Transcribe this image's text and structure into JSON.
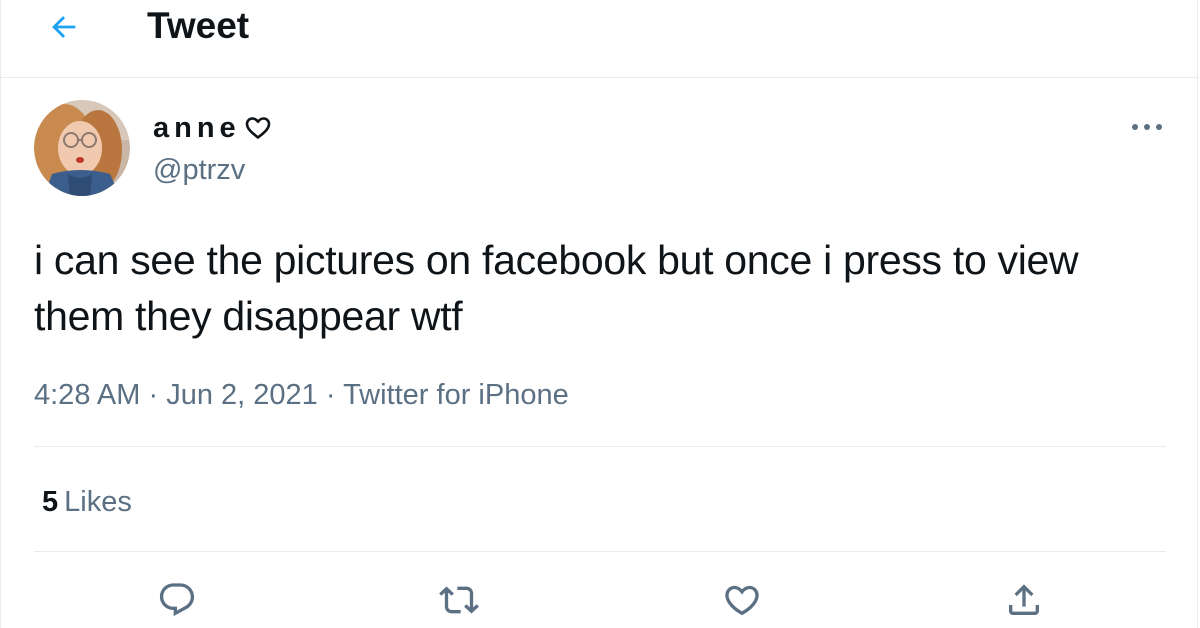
{
  "header": {
    "title": "Tweet",
    "back_icon": "arrow-left-icon",
    "accent_color": "#1da1f2"
  },
  "author": {
    "display_name": "anne",
    "name_emoji": "white-heart-icon",
    "handle": "@ptrzv",
    "avatar": "avatar-photo"
  },
  "tweet": {
    "text": "i can see the pictures on facebook but once i press to view them they disappear wtf"
  },
  "meta": {
    "time": "4:28 AM",
    "separator": "·",
    "date": "Jun 2, 2021",
    "source": "Twitter for iPhone"
  },
  "stats": {
    "likes_count": "5",
    "likes_label": "Likes"
  },
  "actions": [
    {
      "icon": "reply-icon"
    },
    {
      "icon": "retweet-icon"
    },
    {
      "icon": "like-icon"
    },
    {
      "icon": "share-icon"
    }
  ],
  "colors": {
    "text": "#0f1419",
    "secondary": "#5b7083",
    "divider": "#e6ecf0"
  }
}
